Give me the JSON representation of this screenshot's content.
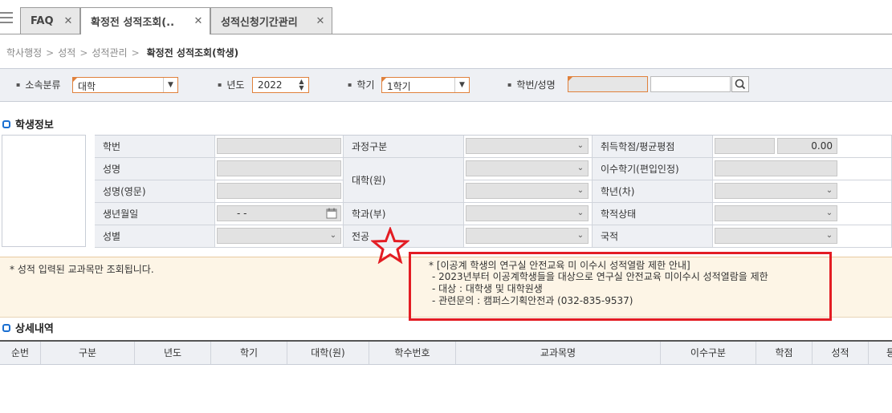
{
  "tabs": [
    {
      "label": "FAQ",
      "close": "✕"
    },
    {
      "label": "확정전 성적조회(..",
      "close": "✕"
    },
    {
      "label": "성적신청기간관리",
      "close": "✕"
    }
  ],
  "breadcrumb": {
    "items": [
      "학사행정",
      "성적",
      "성적관리"
    ],
    "sep": ">",
    "current": "확정전 성적조회(학생)"
  },
  "search": {
    "affiliation": {
      "label": "소속분류",
      "value": "대학"
    },
    "year": {
      "label": "년도",
      "value": "2022"
    },
    "semester": {
      "label": "학기",
      "value": "1학기"
    },
    "student": {
      "label": "학번/성명",
      "value": ""
    }
  },
  "student_info": {
    "title": "학생정보",
    "labels": {
      "student_id": "학번",
      "name": "성명",
      "name_en": "성명(영문)",
      "birth": "생년월일",
      "gender": "성별",
      "course": "과정구분",
      "college": "대학(원)",
      "department": "학과(부)",
      "major": "전공",
      "credits_gpa": "취득학점/평균평점",
      "semesters": "이수학기(편입인정)",
      "grade_year": "학년(차)",
      "status": "학적상태",
      "nationality": "국적"
    },
    "birth_value": "-  -",
    "gpa_value": "0.00"
  },
  "notice": {
    "left": "* 성적 입력된 교과목만 조회됩니다.",
    "lines": [
      "* [이공계 학생의 연구실 안전교육 미 이수시 성적열람 제한 안내]",
      "- 2023년부터 이공계학생들을 대상으로 연구실 안전교육 미이수시 성적열람을 제한",
      "- 대상 : 대학생 및 대학원생",
      "- 관련문의 : 캠퍼스기획안전과 (032-835-9537)"
    ]
  },
  "detail": {
    "title": "상세내역",
    "columns": [
      "순번",
      "구분",
      "년도",
      "학기",
      "대학(원)",
      "학수번호",
      "교과목명",
      "이수구분",
      "학점",
      "성적",
      "등"
    ]
  },
  "colors": {
    "accent": "#1a6fd1",
    "required": "#e0813c",
    "highlight": "#e31c23"
  }
}
